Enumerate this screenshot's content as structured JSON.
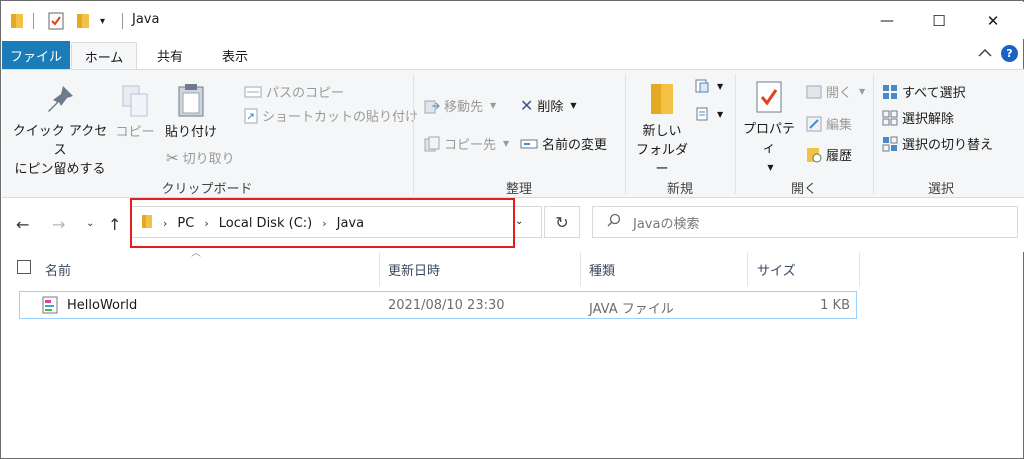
{
  "window": {
    "title": "Java",
    "controls": {
      "minimize": "—",
      "maximize": "☐",
      "close": "✕"
    }
  },
  "tabs": {
    "file": "ファイル",
    "home": "ホーム",
    "share": "共有",
    "view": "表示"
  },
  "ribbon": {
    "clipboard": {
      "pin_line1": "クイック アクセス",
      "pin_line2": "にピン留めする",
      "copy": "コピー",
      "paste": "貼り付け",
      "copy_path": "パスのコピー",
      "paste_shortcut": "ショートカットの貼り付け",
      "cut": "切り取り",
      "label": "クリップボード"
    },
    "organize": {
      "move_to": "移動先",
      "copy_to": "コピー先",
      "delete": "削除",
      "rename": "名前の変更",
      "label": "整理"
    },
    "new": {
      "new_folder_line1": "新しい",
      "new_folder_line2": "フォルダー",
      "label": "新規"
    },
    "open": {
      "properties": "プロパティ",
      "open": "開く",
      "edit": "編集",
      "history": "履歴",
      "label": "開く"
    },
    "select": {
      "select_all": "すべて選択",
      "select_none": "選択解除",
      "invert": "選択の切り替え",
      "label": "選択"
    }
  },
  "address": {
    "crumbs": [
      "PC",
      "Local Disk (C:)",
      "Java"
    ]
  },
  "search": {
    "placeholder": "Javaの検索"
  },
  "columns": {
    "name": "名前",
    "modified": "更新日時",
    "type": "種類",
    "size": "サイズ"
  },
  "files": [
    {
      "name": "HelloWorld",
      "modified": "2021/08/10 23:30",
      "type": "JAVA ファイル",
      "size": "1 KB"
    }
  ],
  "colors": {
    "accent": "#1a7cb8",
    "highlight": "#e02020",
    "folder": "#f3c145"
  }
}
